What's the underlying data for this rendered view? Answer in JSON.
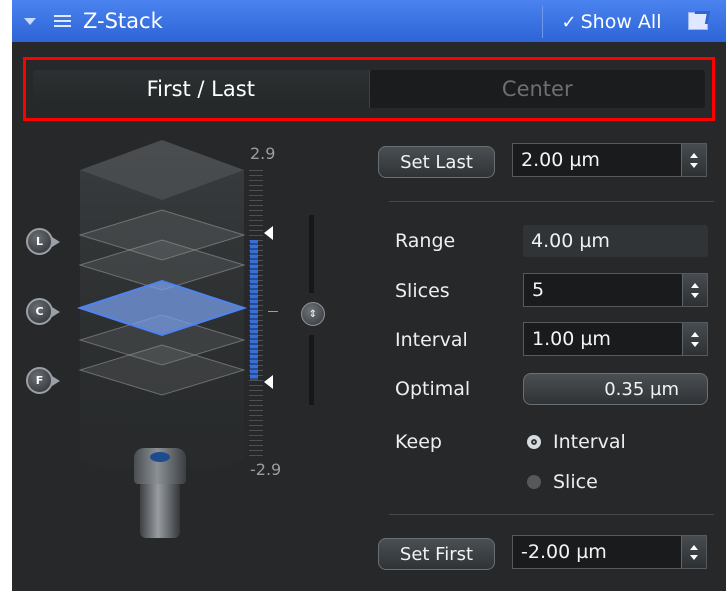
{
  "panel": {
    "title": "Z-Stack",
    "show_all_label": "Show All",
    "icons": {
      "collapse": "chevron-down-icon",
      "grip": "grip-lines-icon",
      "check": "checkmark-icon",
      "popout": "popout-icon"
    },
    "accent": "#2e64d6"
  },
  "tabs": [
    {
      "label": "First / Last",
      "active": true
    },
    {
      "label": "Center",
      "active": false
    }
  ],
  "highlight_color": "#ff0000",
  "stack_visual": {
    "scale_top": "2.9",
    "scale_bottom": "-2.9",
    "markers": [
      "L",
      "C",
      "F"
    ],
    "range_color": "#3b6fd8",
    "center_slice_color": "#7aa3f2"
  },
  "controls": {
    "set_last_label": "Set Last",
    "last_value": "2.00 µm",
    "range_label": "Range",
    "range_value": "4.00 µm",
    "slices_label": "Slices",
    "slices_value": "5",
    "interval_label": "Interval",
    "interval_value": "1.00 µm",
    "optimal_label": "Optimal",
    "optimal_value": "0.35 µm",
    "keep_label": "Keep",
    "keep_options": [
      {
        "label": "Interval",
        "selected": true
      },
      {
        "label": "Slice",
        "selected": false
      }
    ],
    "set_first_label": "Set First",
    "first_value": "-2.00 µm"
  }
}
